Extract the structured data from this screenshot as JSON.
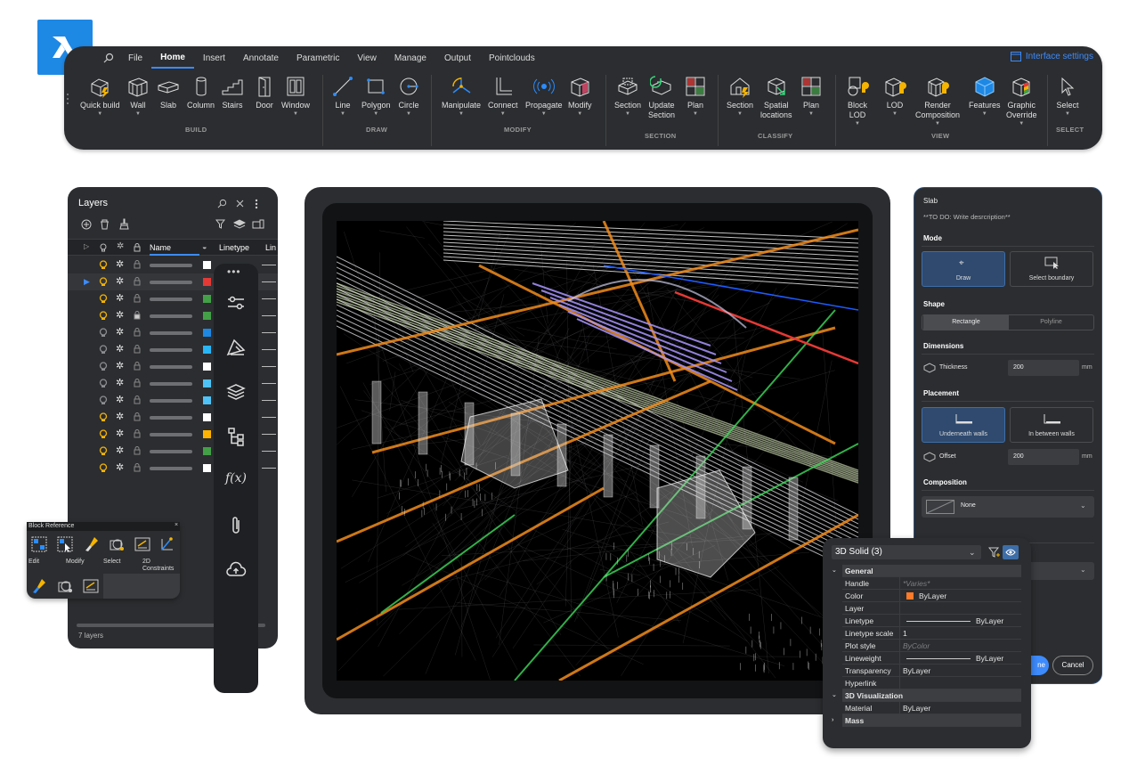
{
  "ribbon": {
    "menu": [
      "File",
      "Home",
      "Insert",
      "Annotate",
      "Parametric",
      "View",
      "Manage",
      "Output",
      "Pointclouds"
    ],
    "active_menu": "Home",
    "interface_settings": "Interface settings",
    "tools": {
      "quick_build": "Quick build",
      "wall": "Wall",
      "slab": "Slab",
      "column": "Column",
      "stairs": "Stairs",
      "door": "Door",
      "window": "Window",
      "line": "Line",
      "polygon": "Polygon",
      "circle": "Circle",
      "manipulate": "Manipulate",
      "connect": "Connect",
      "propagate": "Propagate",
      "modify": "Modify",
      "section1": "Section",
      "update_section_1": "Update",
      "update_section_2": "Section",
      "plan1": "Plan",
      "section2": "Section",
      "spatial_1": "Spatial",
      "spatial_2": "locations",
      "plan2": "Plan",
      "block_lod_1": "Block",
      "block_lod_2": "LOD",
      "lod": "LOD",
      "render_1": "Render",
      "render_2": "Composition",
      "features": "Features",
      "graphic_1": "Graphic",
      "graphic_2": "Override",
      "select": "Select"
    },
    "groups": {
      "build": "BUILD",
      "draw": "DRAW",
      "modify": "MODIFY",
      "section": "SECTION",
      "classify": "CLASSIFY",
      "view": "VIEW",
      "select": "SELECT"
    }
  },
  "layers": {
    "title": "Layers",
    "col_name": "Name",
    "col_linetype": "Linetype",
    "col_lin": "Lin",
    "footer": "7 layers",
    "rows": [
      {
        "on": "on",
        "color": "#ffffff"
      },
      {
        "on": "on",
        "color": "#e53935",
        "current": true
      },
      {
        "on": "on",
        "color": "#43a047"
      },
      {
        "on": "on",
        "color": "#43a047"
      },
      {
        "on": "off",
        "color": "#1e88e5"
      },
      {
        "on": "off",
        "color": "#29b6f6"
      },
      {
        "on": "off",
        "color": "#ffffff"
      },
      {
        "on": "off",
        "color": "#4fc3f7"
      },
      {
        "on": "off",
        "color": "#4fc3f7"
      },
      {
        "on": "on",
        "color": "#ffffff"
      },
      {
        "on": "on",
        "color": "#ffb300"
      },
      {
        "on": "on",
        "color": "#43a047"
      },
      {
        "on": "on",
        "color": "#ffffff"
      }
    ]
  },
  "blockref": {
    "title": "Block Reference",
    "labels": {
      "edit": "Edit",
      "modify": "Modify",
      "select": "Select",
      "constraints_1": "2D",
      "constraints_2": "Constraints"
    }
  },
  "slab": {
    "title": "Slab",
    "description": "**TO DO: Write desrcription**",
    "mode": "Mode",
    "draw": "Draw",
    "select_boundary": "Select boundary",
    "shape": "Shape",
    "rectangle": "Rectangle",
    "polyline": "Polyline",
    "dimensions": "Dimensions",
    "thickness": "Thickness",
    "thickness_value": "200",
    "unit": "mm",
    "placement": "Placement",
    "underneath": "Underneath walls",
    "in_between": "In between walls",
    "offset": "Offset",
    "offset_value": "200",
    "composition": "Composition",
    "composition_value": "None",
    "done": "ne",
    "cancel": "Cancel"
  },
  "props": {
    "selection": "3D Solid (3)",
    "general": "General",
    "rows": [
      {
        "k": "Handle",
        "v": "*Varies*",
        "dim": true
      },
      {
        "k": "Color",
        "v": "ByLayer",
        "swatch": "#ff7b29"
      },
      {
        "k": "Layer",
        "v": ""
      },
      {
        "k": "Linetype",
        "v": "ByLayer",
        "line": true
      },
      {
        "k": "Linetype scale",
        "v": "1"
      },
      {
        "k": "Plot style",
        "v": "ByColor",
        "dim": true
      },
      {
        "k": "Lineweight",
        "v": "ByLayer",
        "line": true
      },
      {
        "k": "Transparency",
        "v": "ByLayer"
      },
      {
        "k": "Hyperlink",
        "v": ""
      }
    ],
    "viz": "3D Visualization",
    "material_k": "Material",
    "material_v": "ByLayer",
    "mass": "Mass"
  }
}
